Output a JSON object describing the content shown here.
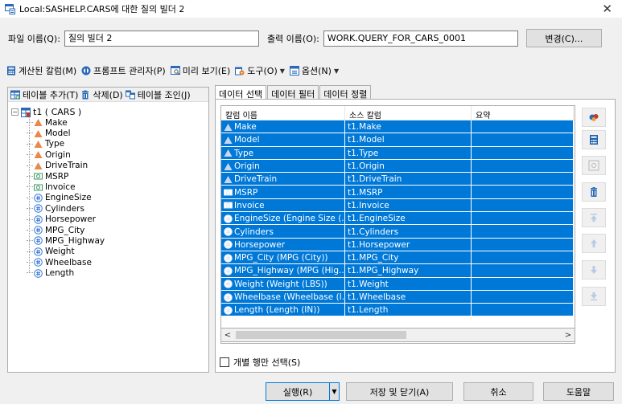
{
  "window": {
    "title": "Local:SASHELP.CARS에 대한 질의 빌더 2",
    "close": "✕"
  },
  "header": {
    "file_label": "파일 이름(Q):",
    "file_value": "질의 빌더 2",
    "output_label": "출력 이름(O):",
    "output_value": "WORK.QUERY_FOR_CARS_0001",
    "change_button": "변경(C)..."
  },
  "toolbar": {
    "computed": "계산된 칼럼(M)",
    "prompt": "프롬프트 관리자(P)",
    "preview": "미리 보기(E)",
    "tools": "도구(O)",
    "options": "옵션(N)"
  },
  "left_toolbar": {
    "add_table": "테이블 추가(T)",
    "delete": "삭제(D)",
    "join": "테이블 조인(J)"
  },
  "tree": {
    "root": "t1 ( CARS )",
    "items": [
      {
        "label": "Make",
        "kind": "char"
      },
      {
        "label": "Model",
        "kind": "char"
      },
      {
        "label": "Type",
        "kind": "char"
      },
      {
        "label": "Origin",
        "kind": "char"
      },
      {
        "label": "DriveTrain",
        "kind": "char"
      },
      {
        "label": "MSRP",
        "kind": "currency"
      },
      {
        "label": "Invoice",
        "kind": "currency"
      },
      {
        "label": "EngineSize",
        "kind": "num"
      },
      {
        "label": "Cylinders",
        "kind": "num"
      },
      {
        "label": "Horsepower",
        "kind": "num"
      },
      {
        "label": "MPG_City",
        "kind": "num"
      },
      {
        "label": "MPG_Highway",
        "kind": "num"
      },
      {
        "label": "Weight",
        "kind": "num"
      },
      {
        "label": "Wheelbase",
        "kind": "num"
      },
      {
        "label": "Length",
        "kind": "num"
      }
    ]
  },
  "tabs": [
    "데이터 선택",
    "데이터 필터",
    "데이터 정렬"
  ],
  "grid": {
    "headers": [
      "칼럼 이름",
      "소스 칼럼",
      "요약"
    ],
    "rows": [
      {
        "name": "Make",
        "source": "t1.Make",
        "kind": "char"
      },
      {
        "name": "Model",
        "source": "t1.Model",
        "kind": "char"
      },
      {
        "name": "Type",
        "source": "t1.Type",
        "kind": "char"
      },
      {
        "name": "Origin",
        "source": "t1.Origin",
        "kind": "char"
      },
      {
        "name": "DriveTrain",
        "source": "t1.DriveTrain",
        "kind": "char"
      },
      {
        "name": "MSRP",
        "source": "t1.MSRP",
        "kind": "currency"
      },
      {
        "name": "Invoice",
        "source": "t1.Invoice",
        "kind": "currency"
      },
      {
        "name": "EngineSize (Engine Size (...",
        "source": "t1.EngineSize",
        "kind": "num"
      },
      {
        "name": "Cylinders",
        "source": "t1.Cylinders",
        "kind": "num"
      },
      {
        "name": "Horsepower",
        "source": "t1.Horsepower",
        "kind": "num"
      },
      {
        "name": "MPG_City (MPG (City))",
        "source": "t1.MPG_City",
        "kind": "num"
      },
      {
        "name": "MPG_Highway (MPG (Hig...",
        "source": "t1.MPG_Highway",
        "kind": "num"
      },
      {
        "name": "Weight (Weight (LBS))",
        "source": "t1.Weight",
        "kind": "num"
      },
      {
        "name": "Wheelbase (Wheelbase (I...",
        "source": "t1.Wheelbase",
        "kind": "num"
      },
      {
        "name": "Length (Length (IN))",
        "source": "t1.Length",
        "kind": "num"
      }
    ]
  },
  "checkbox_label": "개별 행만 선택(S)",
  "buttons": {
    "run": "실행(R)",
    "save_close": "저장 및 닫기(A)",
    "cancel": "취소",
    "help": "도움말"
  },
  "colors": {
    "selection": "#0078d7",
    "char_icon": "#e8884a",
    "num_icon": "#3a7bd5",
    "currency_icon": "#3c9a5f"
  }
}
